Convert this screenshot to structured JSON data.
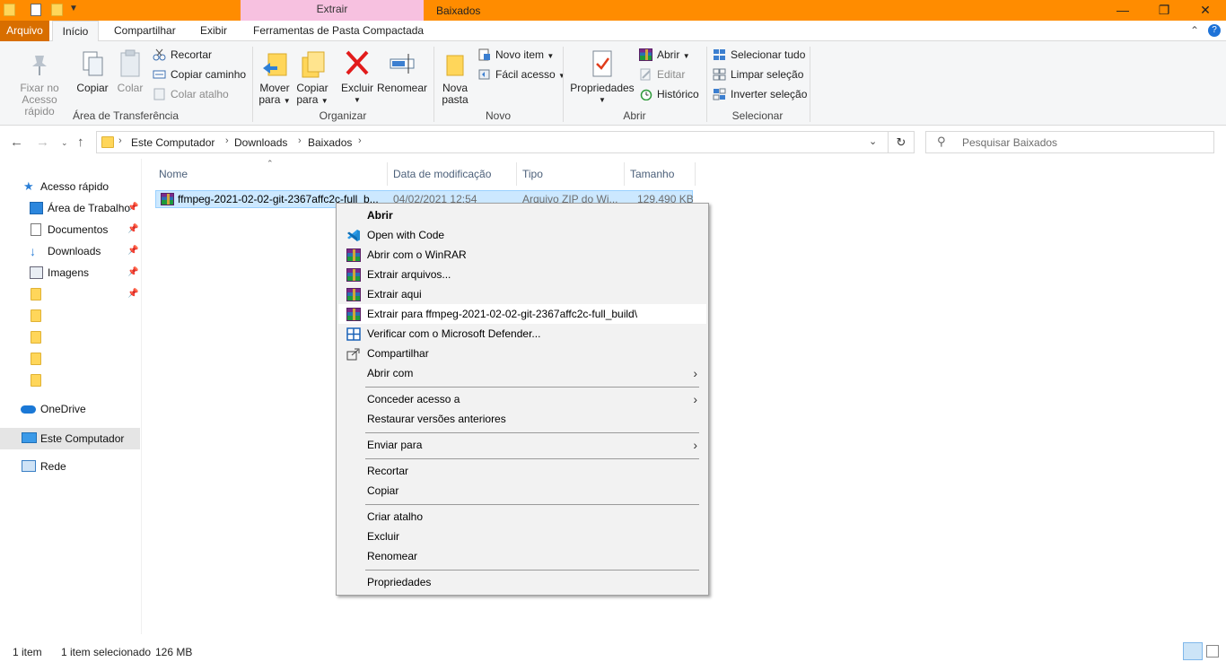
{
  "titlebar": {
    "tool_tab": "Extrair",
    "window_title": "Baixados",
    "minimize": "—",
    "maximize": "❐",
    "close": "✕"
  },
  "tabs": {
    "file": "Arquivo",
    "home": "Início",
    "share": "Compartilhar",
    "view": "Exibir",
    "tools": "Ferramentas de Pasta Compactada"
  },
  "ribbon": {
    "clipboard": {
      "group_label": "Área de Transferência",
      "pin_line1": "Fixar no",
      "pin_line2": "Acesso rápido",
      "copy": "Copiar",
      "paste": "Colar",
      "cut": "Recortar",
      "copy_path": "Copiar caminho",
      "paste_shortcut": "Colar atalho"
    },
    "organize": {
      "group_label": "Organizar",
      "move_line1": "Mover",
      "move_line2": "para",
      "copyto_line1": "Copiar",
      "copyto_line2": "para",
      "delete": "Excluir",
      "rename": "Renomear"
    },
    "new": {
      "group_label": "Novo",
      "new_folder_line1": "Nova",
      "new_folder_line2": "pasta",
      "new_item": "Novo item",
      "easy_access": "Fácil acesso"
    },
    "open": {
      "group_label": "Abrir",
      "properties": "Propriedades",
      "open": "Abrir",
      "edit": "Editar",
      "history": "Histórico"
    },
    "select": {
      "group_label": "Selecionar",
      "select_all": "Selecionar tudo",
      "select_none": "Limpar seleção",
      "invert": "Inverter seleção"
    }
  },
  "address": {
    "crumbs": [
      "Este Computador",
      "Downloads",
      "Baixados"
    ],
    "search_placeholder": "Pesquisar Baixados"
  },
  "sidebar": {
    "quick_access": "Acesso rápido",
    "desktop": "Área de Trabalho",
    "documents": "Documentos",
    "downloads": "Downloads",
    "pictures": "Imagens",
    "onedrive": "OneDrive",
    "this_pc": "Este Computador",
    "network": "Rede"
  },
  "columns": {
    "name": "Nome",
    "modified": "Data de modificação",
    "type": "Tipo",
    "size": "Tamanho"
  },
  "file": {
    "name": "ffmpeg-2021-02-02-git-2367affc2c-full_b...",
    "modified": "04/02/2021 12:54",
    "type": "Arquivo ZIP do Wi...",
    "size": "129.490 KB"
  },
  "context_menu": {
    "open": "Abrir",
    "open_with_code": "Open with Code",
    "open_winrar": "Abrir com o WinRAR",
    "extract_files": "Extrair arquivos...",
    "extract_here": "Extrair aqui",
    "extract_to": "Extrair para ffmpeg-2021-02-02-git-2367affc2c-full_build\\",
    "defender": "Verificar com o Microsoft Defender...",
    "share": "Compartilhar",
    "open_with": "Abrir com",
    "give_access": "Conceder acesso a",
    "restore_versions": "Restaurar versões anteriores",
    "send_to": "Enviar para",
    "cut": "Recortar",
    "copy": "Copiar",
    "create_shortcut": "Criar atalho",
    "delete": "Excluir",
    "rename": "Renomear",
    "properties": "Propriedades"
  },
  "status": {
    "count": "1 item",
    "selected": "1 item selecionado",
    "size": "126 MB"
  }
}
